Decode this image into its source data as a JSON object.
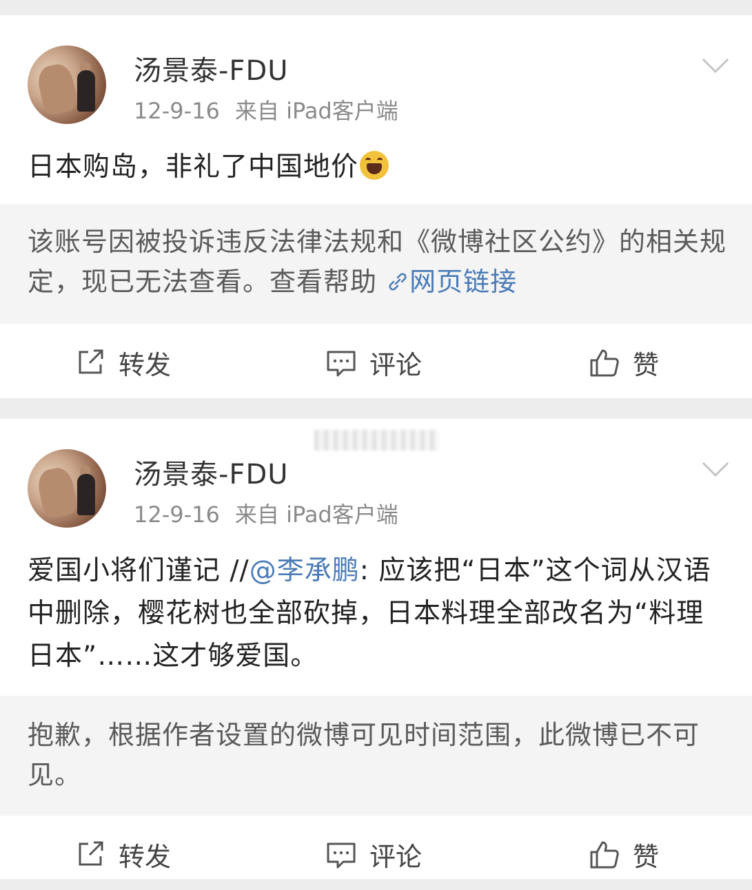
{
  "posts": [
    {
      "username": "汤景泰-FDU",
      "date": "12-9-16",
      "source": "来自 iPad客户端",
      "text": "日本购岛，非礼了中国地价",
      "emoji": "laughing-emoji",
      "notice": {
        "text": "该账号因被投诉违反法律法规和《微博社区公约》的相关规定，现已无法查看。查看帮助 ",
        "link_label": "网页链接"
      },
      "actions": {
        "repost": "转发",
        "comment": "评论",
        "like": "赞"
      }
    },
    {
      "username": "汤景泰-FDU",
      "date": "12-9-16",
      "source": "来自 iPad客户端",
      "text_before": "爱国小将们谨记 //",
      "mention": "@李承鹏",
      "text_after": ": 应该把“日本”这个词从汉语中删除，樱花树也全部砍掉，日本料理全部改名为“料理日本”……这才够爱国。",
      "notice": {
        "text": "抱歉，根据作者设置的微博可见时间范围，此微博已不可见。"
      },
      "actions": {
        "repost": "转发",
        "comment": "评论",
        "like": "赞"
      }
    }
  ],
  "icons": [
    "chevron-down-icon",
    "repost-icon",
    "comment-icon",
    "like-icon",
    "link-icon"
  ],
  "colors": {
    "link": "#4a7bb7",
    "background": "#ededed",
    "notice_bg": "#f4f4f4"
  }
}
